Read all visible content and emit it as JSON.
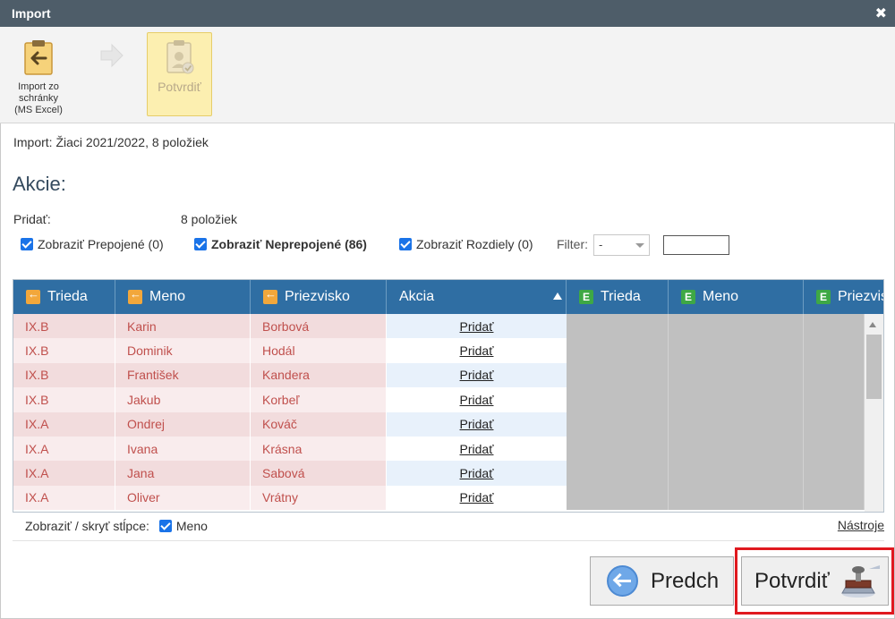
{
  "window": {
    "title": "Import",
    "close_glyph": "✖"
  },
  "toolbar": {
    "import_label": "Import zo schránky (MS Excel)",
    "confirm_label": "Potvrdiť",
    "icons": {
      "import": "clipboard-import-icon",
      "next": "arrow-right-icon",
      "confirm": "clipboard-user-check-icon"
    }
  },
  "info_text": "Import: Žiaci 2021/2022, 8 položiek",
  "section_title": "Akcie:",
  "add": {
    "label": "Pridať:",
    "value": "8 položiek"
  },
  "checkboxes": [
    {
      "label": "Zobraziť Prepojené (0)",
      "checked": true,
      "bold": false
    },
    {
      "label": "Zobraziť Neprepojené (86)",
      "checked": true,
      "bold": true
    },
    {
      "label": "Zobraziť Rozdiely (0)",
      "checked": true,
      "bold": false
    }
  ],
  "filter": {
    "label": "Filter:",
    "selected": "-",
    "input_value": ""
  },
  "grid": {
    "columns": [
      {
        "label": "Trieda",
        "icon": "import-source-icon"
      },
      {
        "label": "Meno",
        "icon": "import-source-icon"
      },
      {
        "label": "Priezvisko",
        "icon": "import-source-icon"
      },
      {
        "label": "Akcia",
        "icon": ""
      },
      {
        "label": "Trieda",
        "icon": "excel-target-icon"
      },
      {
        "label": "Meno",
        "icon": "excel-target-icon"
      },
      {
        "label": "Priezvis",
        "icon": "excel-target-icon"
      }
    ],
    "target_icon_letter": "E",
    "rows": [
      {
        "trieda": "IX.B",
        "meno": "Karin",
        "priezvisko": "Borbová",
        "akcia": "Pridať"
      },
      {
        "trieda": "IX.B",
        "meno": "Dominik",
        "priezvisko": "Hodál",
        "akcia": "Pridať"
      },
      {
        "trieda": "IX.B",
        "meno": "František",
        "priezvisko": "Kandera",
        "akcia": "Pridať"
      },
      {
        "trieda": "IX.B",
        "meno": "Jakub",
        "priezvisko": "Korbeľ",
        "akcia": "Pridať"
      },
      {
        "trieda": "IX.A",
        "meno": "Ondrej",
        "priezvisko": "Kováč",
        "akcia": "Pridať"
      },
      {
        "trieda": "IX.A",
        "meno": "Ivana",
        "priezvisko": "Krásna",
        "akcia": "Pridať"
      },
      {
        "trieda": "IX.A",
        "meno": "Jana",
        "priezvisko": "Sabová",
        "akcia": "Pridať"
      },
      {
        "trieda": "IX.A",
        "meno": "Oliver",
        "priezvisko": "Vrátny",
        "akcia": "Pridať"
      }
    ],
    "footer": {
      "show_hide_label": "Zobraziť / skryť stĺpce:",
      "column_toggle_label": "Meno",
      "tools_label": "Nástroje"
    }
  },
  "buttons": {
    "prev_label": "Predch",
    "confirm_label": "Potvrdiť"
  },
  "colors": {
    "titlebar": "#4e5d69",
    "header": "#2f6ea3",
    "row_even": "#f2dcdd",
    "row_odd": "#f9eced",
    "source_text": "#c0504d",
    "action_even": "#e8f1fb",
    "action_odd": "#ffffff",
    "target_empty": "#c0c0c0",
    "highlight": "#e0191f"
  }
}
